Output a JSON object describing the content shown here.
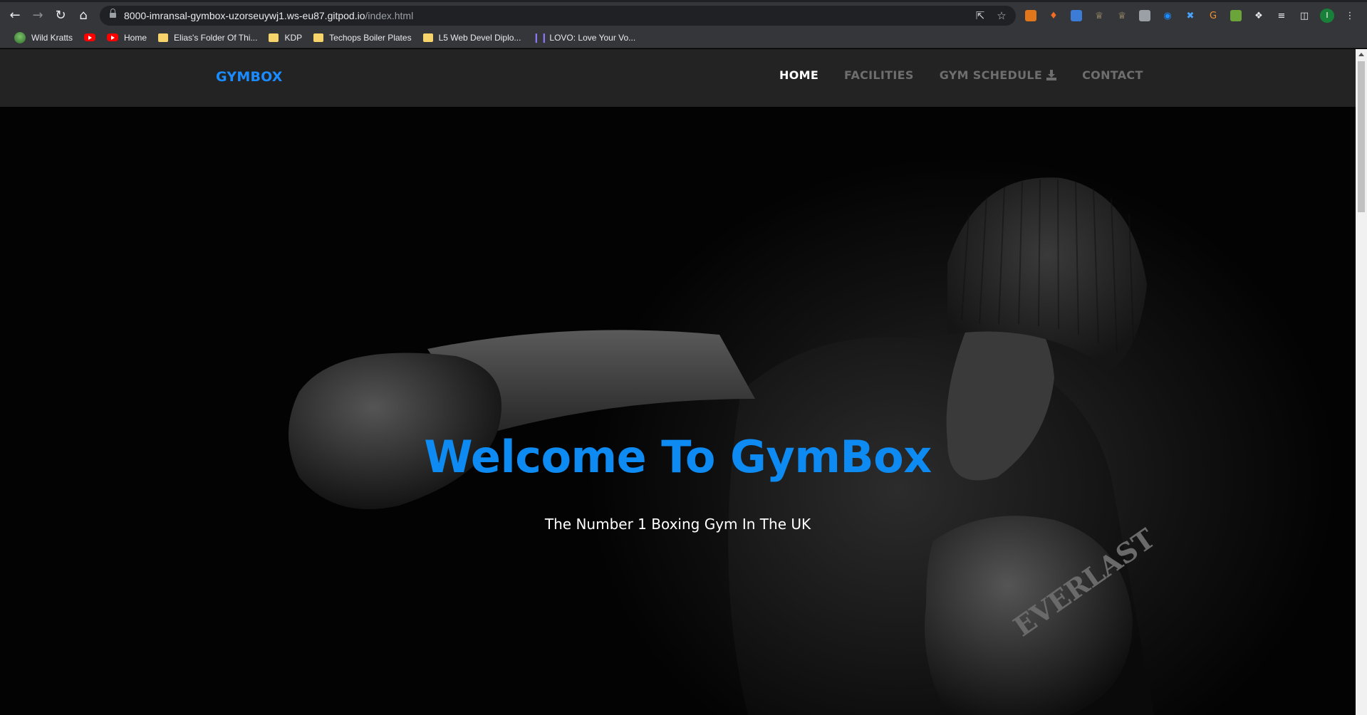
{
  "browser": {
    "url_host": "8000-imransal-gymbox-uzorseuywj1.ws-eu87.gitpod.io",
    "url_path": "/index.html",
    "profile_initial": "I",
    "bookmarks": [
      {
        "label": "Wild Kratts",
        "icon": "wild-kratts-icon"
      },
      {
        "label": "",
        "icon": "youtube-icon"
      },
      {
        "label": "Home",
        "icon": "youtube-icon"
      },
      {
        "label": "Elias's Folder Of Thi...",
        "icon": "folder-icon"
      },
      {
        "label": "KDP",
        "icon": "folder-icon"
      },
      {
        "label": "Techops Boiler Plates",
        "icon": "folder-icon"
      },
      {
        "label": "L5 Web Devel Diplo...",
        "icon": "folder-icon"
      },
      {
        "label": "LOVO: Love Your Vo...",
        "icon": "lovo-icon"
      }
    ]
  },
  "site": {
    "brand": "GYMBOX",
    "nav": {
      "home": "HOME",
      "facilities": "FACILITIES",
      "schedule": "GYM SCHEDULE",
      "contact": "CONTACT"
    },
    "hero": {
      "title": "Welcome To GymBox",
      "subtitle": "The Number 1 Boxing Gym In The UK"
    },
    "colors": {
      "accent": "#0d8bf2",
      "nav_bg": "#232323",
      "nav_active": "#ffffff",
      "nav_inactive": "#6e6e6e"
    }
  }
}
